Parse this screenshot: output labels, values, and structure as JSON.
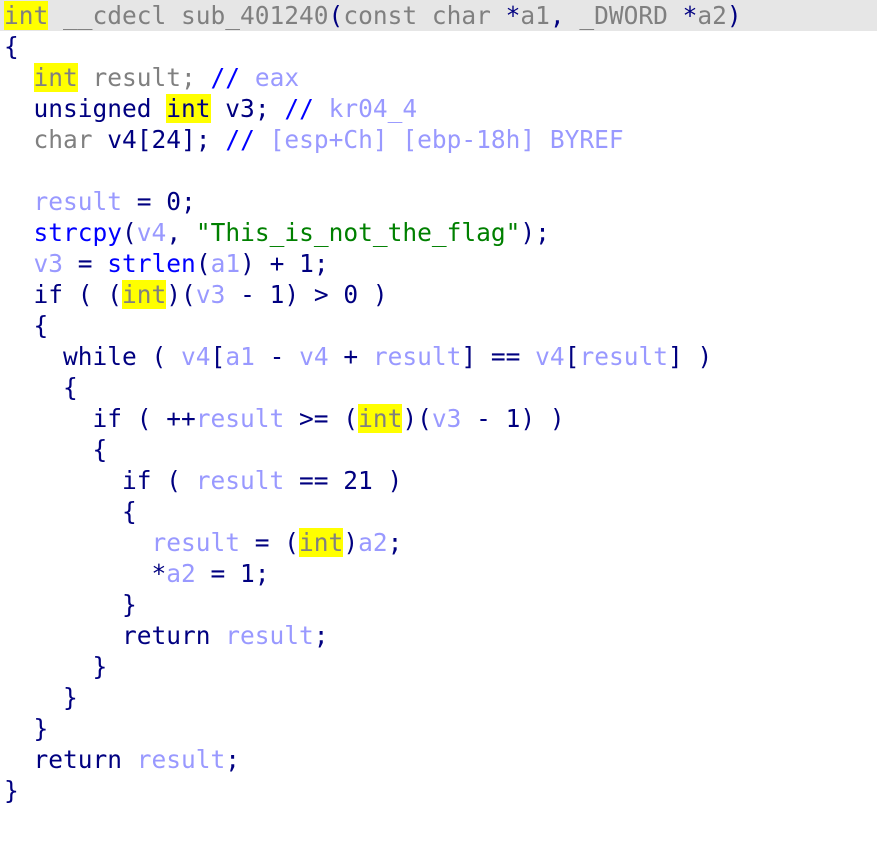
{
  "view": {
    "kind": "hex-rays-pseudocode",
    "highlighted_token": "int",
    "background": "#ffffff",
    "current_line_background": "#e6e6e6",
    "colors": {
      "punctuation": "#000080",
      "keyword": "#000080",
      "declaration": "#808080",
      "function_call": "#0000ff",
      "local_variable": "#9999ff",
      "string_literal": "#008000",
      "comment_marker": "#0000ff",
      "comment_text": "#9999ff",
      "highlight": "#ffff00"
    }
  },
  "code": {
    "line_01": {
      "indent": "",
      "kw_int": "int",
      "cdecl": " __cdecl ",
      "func_name": "sub_401240",
      "paren_open": "(",
      "const": "const char ",
      "star1": "*",
      "a1": "a1",
      "comma": ", ",
      "dword": "_DWORD ",
      "star2": "*",
      "a2": "a2",
      "paren_close": ")"
    },
    "line_02": {
      "text": "{"
    },
    "line_03": {
      "indent": "  ",
      "kw_int": "int",
      "decl": " result; ",
      "cmt_mark": "//",
      "cmt": " eax"
    },
    "line_04": {
      "indent": "  ",
      "unsigned": "unsigned ",
      "kw_int": "int",
      "v3": " v3",
      "semi": "; ",
      "cmt_mark": "//",
      "cmt": " kr04_4"
    },
    "line_05": {
      "indent": "  ",
      "char": "char ",
      "v4": "v4",
      "bracket": "[24]; ",
      "cmt_mark": "//",
      "cmt": " [esp+Ch] [ebp-18h] BYREF"
    },
    "line_06": {
      "text": ""
    },
    "line_07": {
      "indent": "  ",
      "result": "result",
      "rest": " = 0;"
    },
    "line_08": {
      "indent": "  ",
      "func": "strcpy",
      "paren": "(",
      "v4": "v4",
      "comma": ", ",
      "string": "\"This_is_not_the_flag\"",
      "close": ");"
    },
    "line_09": {
      "indent": "  ",
      "v3": "v3",
      "eq": " = ",
      "func": "strlen",
      "paren": "(",
      "a1": "a1",
      "close": ") + 1;"
    },
    "line_10": {
      "indent": "  ",
      "kw_if": "if ( (",
      "cast": "int",
      "mid": ")(",
      "v3": "v3",
      "close": " - 1) > 0 )"
    },
    "line_11": {
      "text": "  {"
    },
    "line_12": {
      "indent": "    ",
      "kw_while": "while ( ",
      "v4a": "v4",
      "b1": "[",
      "a1": "a1",
      "op1": " - ",
      "v4b": "v4",
      "op2": " + ",
      "res1": "result",
      "b2": "] == ",
      "v4c": "v4",
      "b3": "[",
      "res2": "result",
      "b4": "] )"
    },
    "line_13": {
      "text": "    {"
    },
    "line_14": {
      "indent": "      ",
      "kw_if": "if ( ++",
      "result": "result",
      "op": " >= (",
      "cast": "int",
      "mid": ")(",
      "v3": "v3",
      "close": " - 1) )"
    },
    "line_15": {
      "text": "      {"
    },
    "line_16": {
      "indent": "        ",
      "kw_if": "if ( ",
      "result": "result",
      "close": " == 21 )"
    },
    "line_17": {
      "text": "        {"
    },
    "line_18": {
      "indent": "          ",
      "result": "result",
      "eq": " = (",
      "cast": "int",
      "mid": ")",
      "a2": "a2",
      "semi": ";"
    },
    "line_19": {
      "indent": "          ",
      "star": "*",
      "a2": "a2",
      "rest": " = 1;"
    },
    "line_20": {
      "text": "        }"
    },
    "line_21": {
      "indent": "        ",
      "kw_return": "return ",
      "result": "result",
      "semi": ";"
    },
    "line_22": {
      "text": "      }"
    },
    "line_23": {
      "text": "    }"
    },
    "line_24": {
      "text": "  }"
    },
    "line_25": {
      "indent": "  ",
      "kw_return": "return ",
      "result": "result",
      "semi": ";"
    },
    "line_26": {
      "text": "}"
    }
  }
}
